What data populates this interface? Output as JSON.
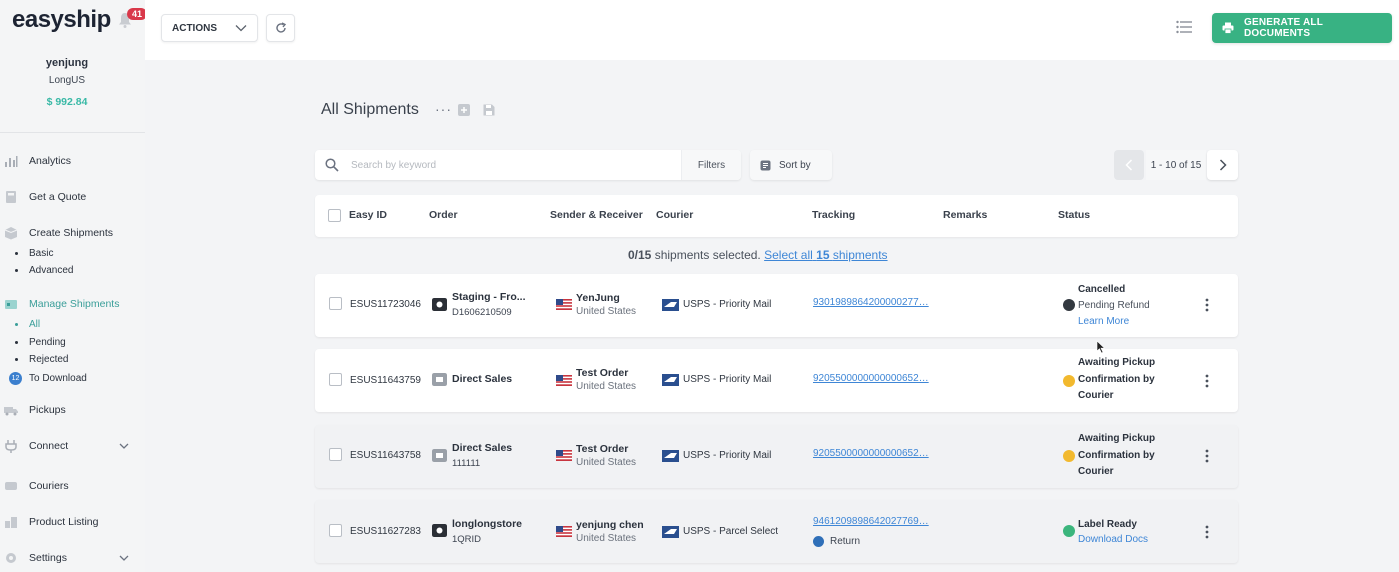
{
  "brand": {
    "logo": "easyship",
    "notification_count": "41"
  },
  "user": {
    "name": "yenjung",
    "company": "LongUS",
    "balance": "$ 992.84"
  },
  "sidebar": {
    "items": [
      {
        "label": "Analytics",
        "icon": "analytics-icon"
      },
      {
        "label": "Get a Quote",
        "icon": "calculator-icon"
      },
      {
        "label": "Create Shipments",
        "icon": "box-icon"
      },
      {
        "label": "Manage Shipments",
        "icon": "manage-icon"
      },
      {
        "label": "Pickups",
        "icon": "truck-icon"
      },
      {
        "label": "Connect",
        "icon": "plug-icon"
      },
      {
        "label": "Couriers",
        "icon": "courier-icon"
      },
      {
        "label": "Product Listing",
        "icon": "product-icon"
      },
      {
        "label": "Settings",
        "icon": "gear-icon"
      }
    ],
    "create_sub": [
      "Basic",
      "Advanced"
    ],
    "manage_sub": [
      "All",
      "Pending",
      "Rejected",
      "To Download"
    ],
    "to_download_badge": "12"
  },
  "toolbar": {
    "actions_label": "ACTIONS",
    "generate_label": "GENERATE ALL DOCUMENTS"
  },
  "main": {
    "title": "All Shipments",
    "title_dots": "···",
    "search_placeholder": "Search by keyword",
    "filters_label": "Filters",
    "sort_label": "Sort by",
    "pager": "1 - 10 of 15",
    "columns": [
      "Easy ID",
      "Order",
      "Sender & Receiver",
      "Courier",
      "Tracking",
      "Remarks",
      "Status"
    ],
    "selection": {
      "count": "0/15",
      "text": "shipments selected.",
      "link_prefix": "Select all",
      "link_count": "15",
      "link_suffix": "shipments"
    }
  },
  "rows": [
    {
      "easy_id": "ESUS11723046",
      "order_title": "Staging - Fro...",
      "order_sub": "D1606210509",
      "sender": "YenJung",
      "country": "United States",
      "courier": "USPS - Priority Mail",
      "tracking": "9301989864200000277…",
      "status_title": "Cancelled",
      "status_line": "Pending Refund",
      "status_link": "Learn More",
      "status_color": "#333940"
    },
    {
      "easy_id": "ESUS11643759",
      "order_title": "Direct Sales",
      "order_sub": "",
      "sender": "Test Order",
      "country": "United States",
      "courier": "USPS - Priority Mail",
      "tracking": "9205500000000000652…",
      "status_multi": "Awaiting Pickup Confirmation by Courier",
      "status_color": "#f2b92e"
    },
    {
      "easy_id": "ESUS11643758",
      "order_title": "Direct Sales",
      "order_sub": "111111",
      "sender": "Test Order",
      "country": "United States",
      "courier": "USPS - Priority Mail",
      "tracking": "9205500000000000652…",
      "status_multi": "Awaiting Pickup Confirmation by Courier",
      "status_color": "#f2b92e"
    },
    {
      "easy_id": "ESUS11627283",
      "order_title": "longlongstore",
      "order_sub": "1QRID",
      "sender": "yenjung chen",
      "country": "United States",
      "courier": "USPS - Parcel Select",
      "tracking": "9461209898642027769…",
      "return_label": "Return",
      "status_title": "Label Ready",
      "status_link": "Download Docs",
      "status_color": "#3bb57c"
    }
  ],
  "colors": {
    "accent": "#38b283",
    "link": "#3e86d6",
    "teal": "#3a9e99",
    "badge": "#d9384a"
  }
}
